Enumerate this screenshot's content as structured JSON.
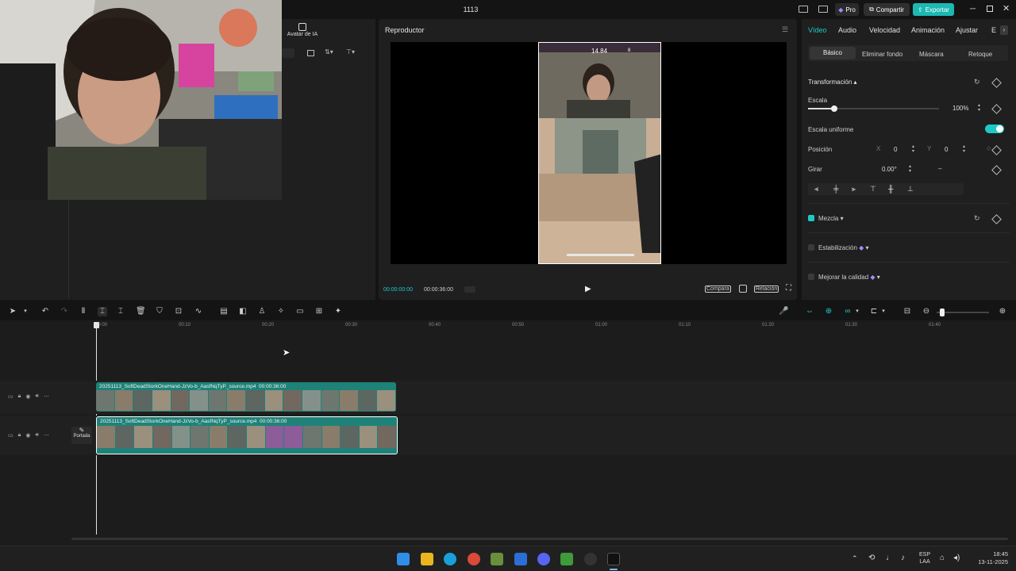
{
  "window": {
    "title": "1113",
    "pro_label": "Pro",
    "share_label": "Compartir",
    "export_label": "Exportar"
  },
  "left_panel": {
    "avatar_label": "Avatar de IA"
  },
  "player": {
    "title": "Reproductor",
    "current_time": "00:00:00:00",
    "total_time": "00:00:36:00",
    "compare_label": "Compara",
    "ratio_label": "Relación",
    "hud_value": "14.84",
    "hud_small": "8"
  },
  "props": {
    "tabs": [
      "Vídeo",
      "Audio",
      "Velocidad",
      "Animación",
      "Ajustar",
      "E"
    ],
    "subtabs": [
      "Básico",
      "Eliminar fondo",
      "Máscara",
      "Retoque"
    ],
    "transform_label": "Transformación",
    "scale_label": "Escala",
    "scale_value": "100%",
    "scale_fraction": 0.2,
    "uniform_label": "Escala uniforme",
    "position_label": "Posición",
    "x_label": "X",
    "x_value": "0",
    "y_label": "Y",
    "y_value": "0",
    "rotate_label": "Girar",
    "rotate_value": "0.00°",
    "rotate_dash": "–",
    "blend_label": "Mezcla",
    "stabilize_label": "Estabilización",
    "quality_label": "Mejorar la calidad"
  },
  "timeline": {
    "ticks": [
      "00:00",
      "00:10",
      "00:20",
      "00:30",
      "00:40",
      "00:50",
      "01:00",
      "01:10",
      "01:20",
      "01:30",
      "01:40"
    ],
    "clip1_name": "20251113_SoftDeadStorkOneHand-JzVo-b_AasfNqTyP_source.mp4",
    "clip1_duration": "00:00:36:00",
    "clip2_name": "20251113_SoftDeadStorkOneHand-JzVo-b_AasfNqTyP_source.mp4",
    "clip2_duration": "00:00:36:00",
    "cover_label": "Portada"
  },
  "taskbar": {
    "lang_top": "ESP",
    "lang_bottom": "LAA",
    "time": "18:45",
    "date": "13-11-2025"
  },
  "colors": {
    "accent": "#1ec8c8",
    "clip": "#1f8278",
    "share_bg": "#2a2a2a",
    "export_bg": "#1bb9b2"
  }
}
